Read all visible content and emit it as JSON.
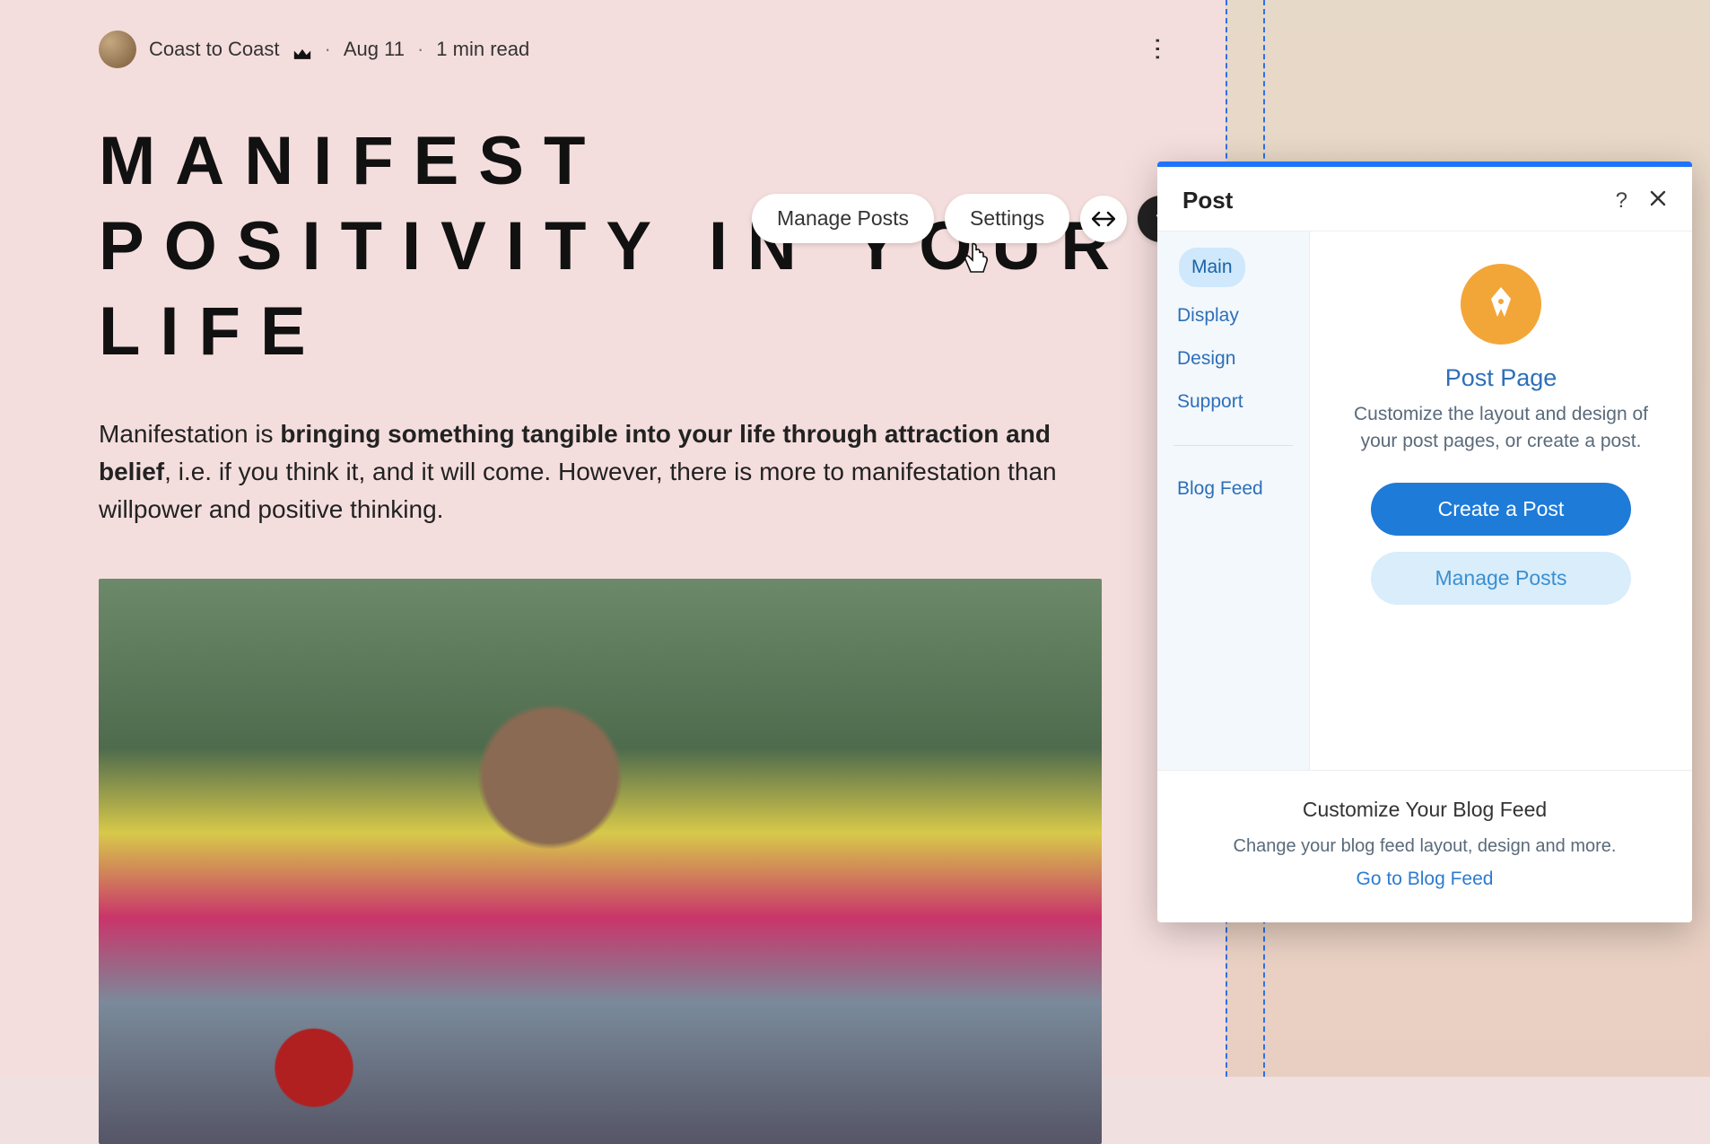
{
  "post": {
    "author": "Coast to Coast",
    "date": "Aug 11",
    "read_time": "1 min read",
    "title": "Manifest Positivity in Your Life",
    "body_prefix": "Manifestation is ",
    "body_bold": "bringing something tangible into your life through attraction and belief",
    "body_suffix": ", i.e. if you think it, and it will come. However, there is more to manifestation than willpower and positive thinking."
  },
  "toolbar": {
    "manage_posts": "Manage Posts",
    "settings": "Settings"
  },
  "panel": {
    "title": "Post",
    "side": {
      "items": [
        "Main",
        "Display",
        "Design",
        "Support"
      ],
      "extra": "Blog Feed"
    },
    "main": {
      "heading": "Post Page",
      "desc": "Customize the layout and design of your post pages, or create a post.",
      "create": "Create a Post",
      "manage": "Manage Posts"
    },
    "footer": {
      "heading": "Customize Your Blog Feed",
      "desc": "Change your blog feed layout, design and more.",
      "link": "Go to Blog Feed"
    }
  }
}
